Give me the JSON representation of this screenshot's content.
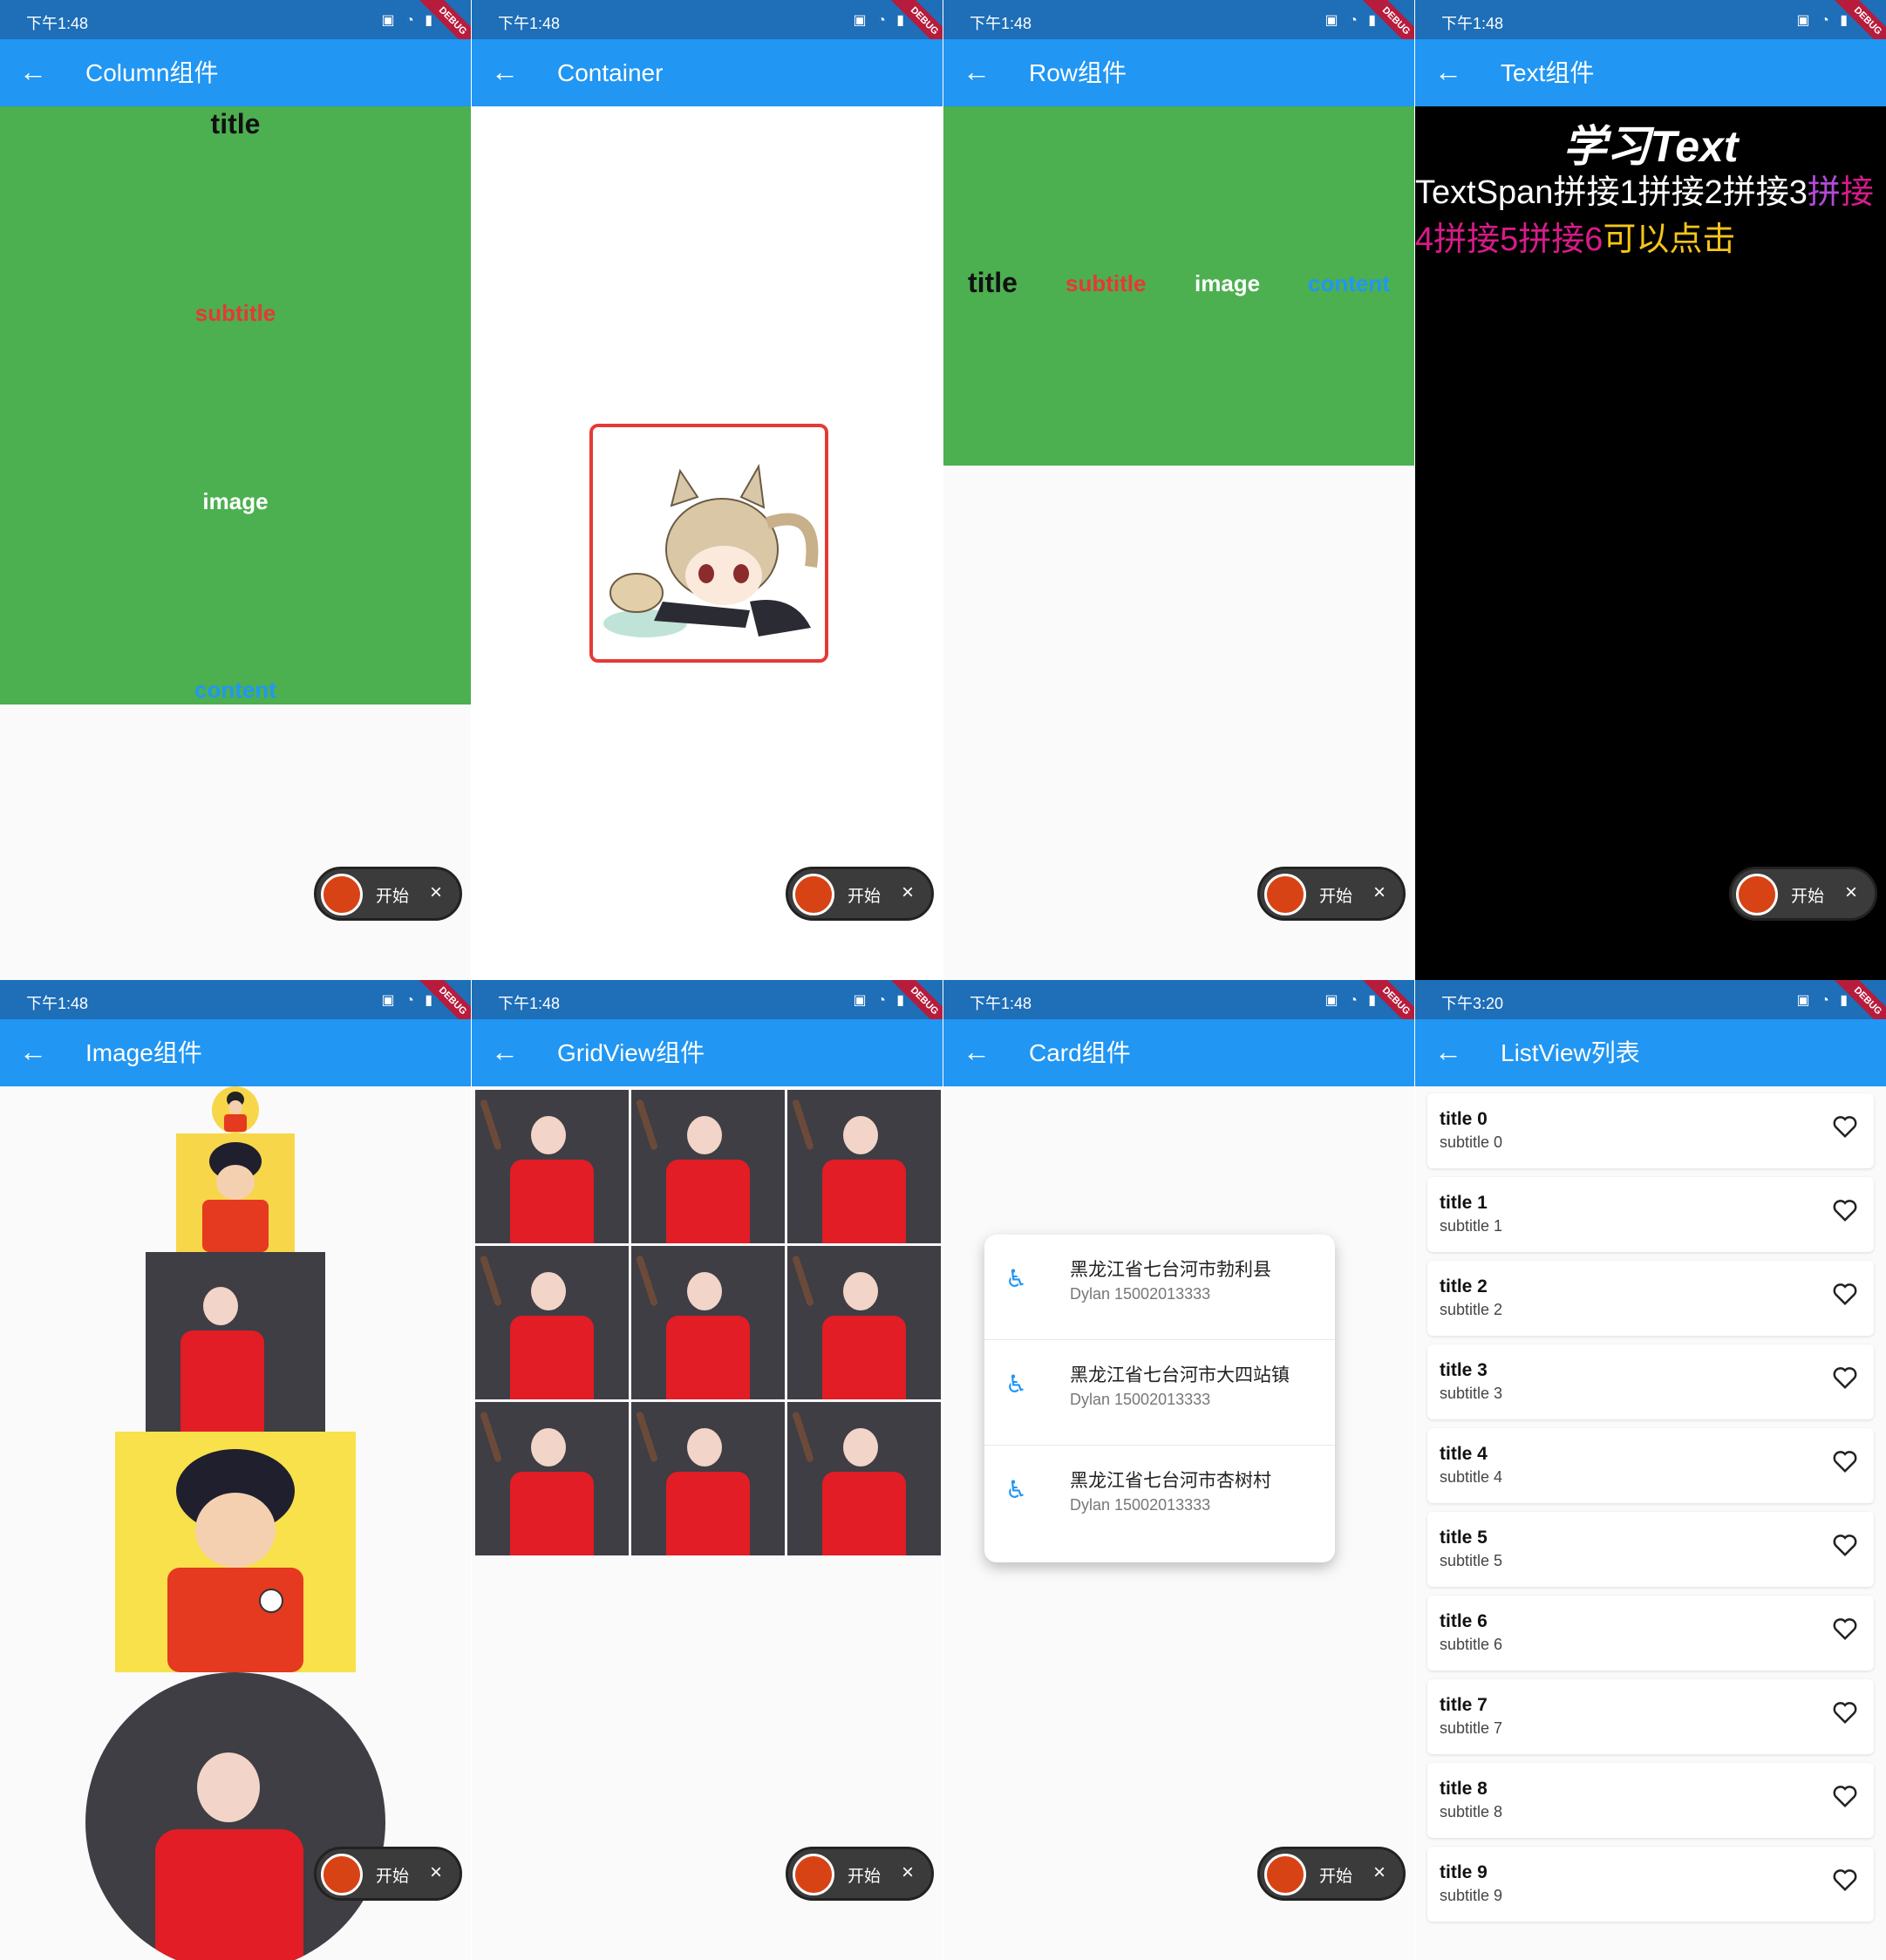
{
  "status_time": "下午1:48",
  "status_time_list": "下午3:20",
  "debug_label": "DEBUG",
  "back_glyph": "←",
  "fab": {
    "label": "开始",
    "close": "×"
  },
  "column_page": {
    "title": "Column组件",
    "items": [
      "title",
      "subtitle",
      "image",
      "content"
    ]
  },
  "container_page": {
    "title": "Container"
  },
  "row_page": {
    "title": "Row组件",
    "items": [
      "title",
      "subtitle",
      "image",
      "content"
    ]
  },
  "text_page": {
    "title": "Text组件",
    "heading": "学习Text",
    "spans": [
      "TextSpan拼接1拼接2拼接3",
      "拼",
      "接4拼接5拼接6",
      "可以点击"
    ]
  },
  "image_page": {
    "title": "Image组件"
  },
  "gridview_page": {
    "title": "GridView组件"
  },
  "card_page": {
    "title": "Card组件",
    "rows": [
      {
        "title": "黑龙江省七台河市勃利县",
        "subtitle": "Dylan 15002013333"
      },
      {
        "title": "黑龙江省七台河市大四站镇",
        "subtitle": "Dylan 15002013333"
      },
      {
        "title": "黑龙江省七台河市杏树村",
        "subtitle": "Dylan 15002013333"
      }
    ]
  },
  "listview_page": {
    "title": "ListView列表",
    "items": [
      {
        "title": "title  0",
        "subtitle": "subtitle  0"
      },
      {
        "title": "title  1",
        "subtitle": "subtitle  1"
      },
      {
        "title": "title  2",
        "subtitle": "subtitle  2"
      },
      {
        "title": "title  3",
        "subtitle": "subtitle  3"
      },
      {
        "title": "title  4",
        "subtitle": "subtitle  4"
      },
      {
        "title": "title  5",
        "subtitle": "subtitle  5"
      },
      {
        "title": "title  6",
        "subtitle": "subtitle  6"
      },
      {
        "title": "title  7",
        "subtitle": "subtitle  7"
      },
      {
        "title": "title  8",
        "subtitle": "subtitle  8"
      },
      {
        "title": "title  9",
        "subtitle": "subtitle  9"
      }
    ]
  },
  "colors": {
    "appbar": "#2196f3",
    "statusbar": "#1e6eb8",
    "green": "#4caf50",
    "red": "#e53935",
    "blue": "#2196f3"
  }
}
